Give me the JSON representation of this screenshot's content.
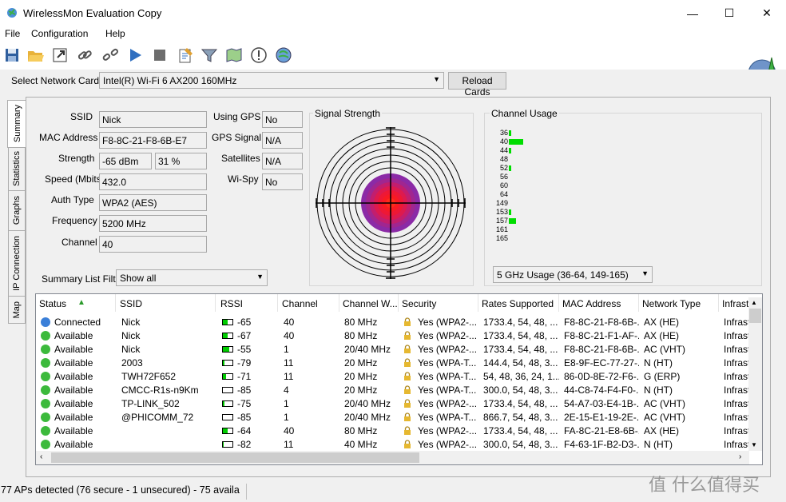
{
  "window": {
    "title": "WirelessMon Evaluation Copy",
    "minimize": "—",
    "maximize": "☐",
    "close": "✕"
  },
  "menu": [
    "File",
    "Configuration",
    "Help"
  ],
  "toolbar_icons": [
    "save-icon",
    "open-icon",
    "export-icon",
    "connect-icon",
    "disconnect-icon",
    "play-icon",
    "stop-icon",
    "notes-icon",
    "filter-icon",
    "map-icon",
    "help-icon",
    "about-icon"
  ],
  "network_card": {
    "label": "Select Network Card",
    "value": "Intel(R) Wi-Fi 6 AX200 160MHz",
    "reload_label": "Reload Cards"
  },
  "tabs": [
    "Summary",
    "Statistics",
    "Graphs",
    "IP Connection",
    "Map"
  ],
  "summary": {
    "ssid_label": "SSID",
    "ssid": "Nick",
    "mac_label": "MAC Address",
    "mac": "F8-8C-21-F8-6B-E7",
    "strength_label": "Strength",
    "strength_dbm": "-65 dBm",
    "strength_pct": "31 %",
    "speed_label": "Speed (Mbits)",
    "speed": "432.0",
    "auth_label": "Auth Type",
    "auth": "WPA2 (AES)",
    "freq_label": "Frequency",
    "freq": "5200 MHz",
    "channel_label": "Channel",
    "channel": "40",
    "gps_label": "Using GPS",
    "gps": "No",
    "gps_signal_label": "GPS Signal",
    "gps_signal": "N/A",
    "satellites_label": "Satellites",
    "satellites": "N/A",
    "wispy_label": "Wi-Spy",
    "wispy": "No"
  },
  "signal_strength": {
    "title": "Signal Strength"
  },
  "channel_usage": {
    "title": "Channel Usage",
    "channels": [
      "36",
      "40",
      "44",
      "48",
      "52",
      "56",
      "60",
      "64",
      "149",
      "153",
      "157",
      "161",
      "165"
    ],
    "usage": [
      1,
      6,
      1,
      0,
      1,
      0,
      0,
      0,
      0,
      1,
      3,
      0,
      0
    ],
    "select_value": "5 GHz Usage (36-64, 149-165)"
  },
  "filter": {
    "label": "Summary List Filter:",
    "value": "Show all"
  },
  "table": {
    "columns": [
      "Status",
      "SSID",
      "RSSI",
      "Channel",
      "Channel W...",
      "Security",
      "Rates Supported",
      "MAC Address",
      "Network Type",
      "Infrastr"
    ],
    "rows": [
      {
        "status": "Connected",
        "ssid": "Nick",
        "rssi": "-65",
        "rssi_level": 0.5,
        "channel": "40",
        "width": "80 MHz",
        "security": "Yes (WPA2-...",
        "rates": "1733.4, 54, 48, ...",
        "mac": "F8-8C-21-F8-6B-...",
        "type": "AX (HE)",
        "infra": "Infrastr"
      },
      {
        "status": "Available",
        "ssid": "Nick",
        "rssi": "-67",
        "rssi_level": 0.5,
        "channel": "40",
        "width": "80 MHz",
        "security": "Yes (WPA2-...",
        "rates": "1733.4, 54, 48, ...",
        "mac": "F8-8C-21-F1-AF-...",
        "type": "AX (HE)",
        "infra": "Infrastr"
      },
      {
        "status": "Available",
        "ssid": "Nick",
        "rssi": "-55",
        "rssi_level": 0.65,
        "channel": "1",
        "width": "20/40 MHz",
        "security": "Yes (WPA2-...",
        "rates": "1733.4, 54, 48, ...",
        "mac": "F8-8C-21-F8-6B-...",
        "type": "AC (VHT)",
        "infra": "Infrastr"
      },
      {
        "status": "Available",
        "ssid": "2003",
        "rssi": "-79",
        "rssi_level": 0.15,
        "channel": "11",
        "width": "20 MHz",
        "security": "Yes (WPA-T...",
        "rates": "144.4, 54, 48, 3...",
        "mac": "E8-9F-EC-77-27-...",
        "type": "N (HT)",
        "infra": "Infrastr"
      },
      {
        "status": "Available",
        "ssid": "TWH72F652",
        "rssi": "-71",
        "rssi_level": 0.3,
        "channel": "11",
        "width": "20 MHz",
        "security": "Yes (WPA-T...",
        "rates": "54, 48, 36, 24, 1...",
        "mac": "86-0D-8E-72-F6-...",
        "type": "G (ERP)",
        "infra": "Infrastr"
      },
      {
        "status": "Available",
        "ssid": "CMCC-R1s-n9Km",
        "rssi": "-85",
        "rssi_level": 0,
        "channel": "4",
        "width": "20 MHz",
        "security": "Yes (WPA-T...",
        "rates": "300.0, 54, 48, 3...",
        "mac": "44-C8-74-F4-F0-...",
        "type": "N (HT)",
        "infra": "Infrastr"
      },
      {
        "status": "Available",
        "ssid": "TP-LINK_502",
        "rssi": "-75",
        "rssi_level": 0.2,
        "channel": "1",
        "width": "20/40 MHz",
        "security": "Yes (WPA2-...",
        "rates": "1733.4, 54, 48, ...",
        "mac": "54-A7-03-E4-1B-...",
        "type": "AC (VHT)",
        "infra": "Infrastr"
      },
      {
        "status": "Available",
        "ssid": "@PHICOMM_72",
        "rssi": "-85",
        "rssi_level": 0,
        "channel": "1",
        "width": "20/40 MHz",
        "security": "Yes (WPA-T...",
        "rates": "866.7, 54, 48, 3...",
        "mac": "2E-15-E1-19-2E-...",
        "type": "AC (VHT)",
        "infra": "Infrastr"
      },
      {
        "status": "Available",
        "ssid": "",
        "rssi": "-64",
        "rssi_level": 0.5,
        "channel": "40",
        "width": "80 MHz",
        "security": "Yes (WPA2-...",
        "rates": "1733.4, 54, 48, ...",
        "mac": "FA-8C-21-E8-6B-...",
        "type": "AX (HE)",
        "infra": "Infrastr"
      },
      {
        "status": "Available",
        "ssid": "",
        "rssi": "-82",
        "rssi_level": 0.05,
        "channel": "11",
        "width": "40 MHz",
        "security": "Yes (WPA2-...",
        "rates": "300.0, 54, 48, 3...",
        "mac": "F4-63-1F-B2-D3-...",
        "type": "N (HT)",
        "infra": "Infrastr"
      }
    ]
  },
  "status_bar": "77 APs detected (76 secure - 1 unsecured) - 75 availa",
  "watermark": "值 什么值得买",
  "colors": {
    "connected": "#3a7fd8",
    "available": "#3cba3c",
    "bar_green": "#00dd00"
  }
}
